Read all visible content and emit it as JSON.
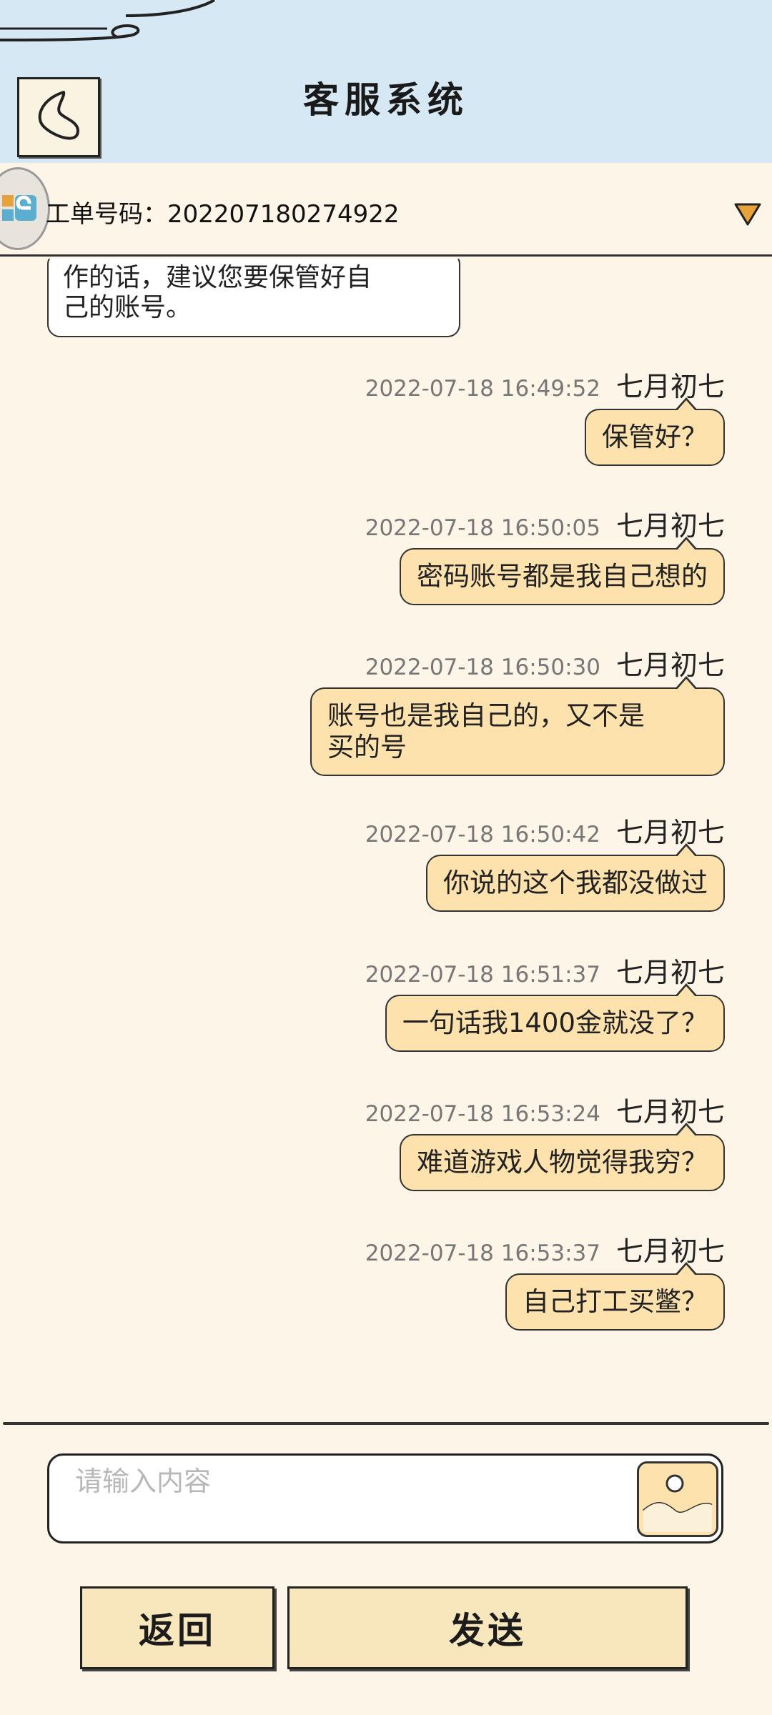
{
  "header": {
    "title": "客服系统",
    "back_icon": "chevron-left-heart-icon"
  },
  "ticket": {
    "label": "工单号码：202207180274922",
    "toggle_icon": "triangle-down-icon"
  },
  "incoming": {
    "text_line1": "作的话，建议您要保管好自",
    "text_line2": "己的账号。"
  },
  "messages": [
    {
      "time": "2022-07-18 16:49:52",
      "name": "七月初七",
      "text": "保管好？"
    },
    {
      "time": "2022-07-18 16:50:05",
      "name": "七月初七",
      "text": "密码账号都是我自己想的"
    },
    {
      "time": "2022-07-18 16:50:30",
      "name": "七月初七",
      "text_line1": "账号也是我自己的，又不是",
      "text_line2": "买的号"
    },
    {
      "time": "2022-07-18 16:50:42",
      "name": "七月初七",
      "text": "你说的这个我都没做过"
    },
    {
      "time": "2022-07-18 16:51:37",
      "name": "七月初七",
      "text": "一句话我1400金就没了？"
    },
    {
      "time": "2022-07-18 16:53:24",
      "name": "七月初七",
      "text": "难道游戏人物觉得我穷？"
    },
    {
      "time": "2022-07-18 16:53:37",
      "name": "七月初七",
      "text": "自己打工买鳖？"
    }
  ],
  "composer": {
    "placeholder": "请输入内容",
    "image_icon": "image-icon"
  },
  "buttons": {
    "back": "返回",
    "send": "发送"
  },
  "colors": {
    "header_bg": "#d6e8f4",
    "page_bg": "#fdf5e8",
    "bubble_out": "#fde2ae",
    "button_bg": "#f8e6bd"
  }
}
